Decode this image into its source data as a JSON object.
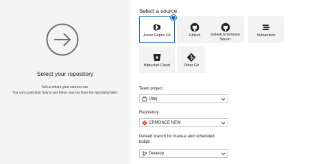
{
  "left": {
    "title": "Select your repository",
    "description_line1": "Tell us where your sources are.",
    "description_line2": "You can customize how to get these sources from the repository later."
  },
  "sources": {
    "heading": "Select a source",
    "tiles": [
      {
        "label": "Azure Repos Git",
        "icon": "azure-repos-icon",
        "selected": true
      },
      {
        "label": "GitHub",
        "icon": "github-icon",
        "selected": false
      },
      {
        "label": "GitHub Enterprise Server",
        "icon": "github-enterprise-icon",
        "selected": false
      },
      {
        "label": "Subversion",
        "icon": "subversion-icon",
        "selected": false
      },
      {
        "label": "Bitbucket Cloud",
        "icon": "bitbucket-icon",
        "selected": false
      },
      {
        "label": "Other Git",
        "icon": "git-icon",
        "selected": false
      }
    ]
  },
  "team_project": {
    "label": "Team project",
    "value": "Uttej"
  },
  "repository": {
    "label": "Repository",
    "value": "CRMONCE NEW"
  },
  "branch": {
    "label_line1": "Default branch for manual and scheduled",
    "label_line2": "builds",
    "value": "Develop"
  },
  "colors": {
    "accent": "#1a6fc2",
    "git_orange": "#e24a2f",
    "tile_bg": "#f3f3f3",
    "left_bg": "#f4f4f4"
  }
}
